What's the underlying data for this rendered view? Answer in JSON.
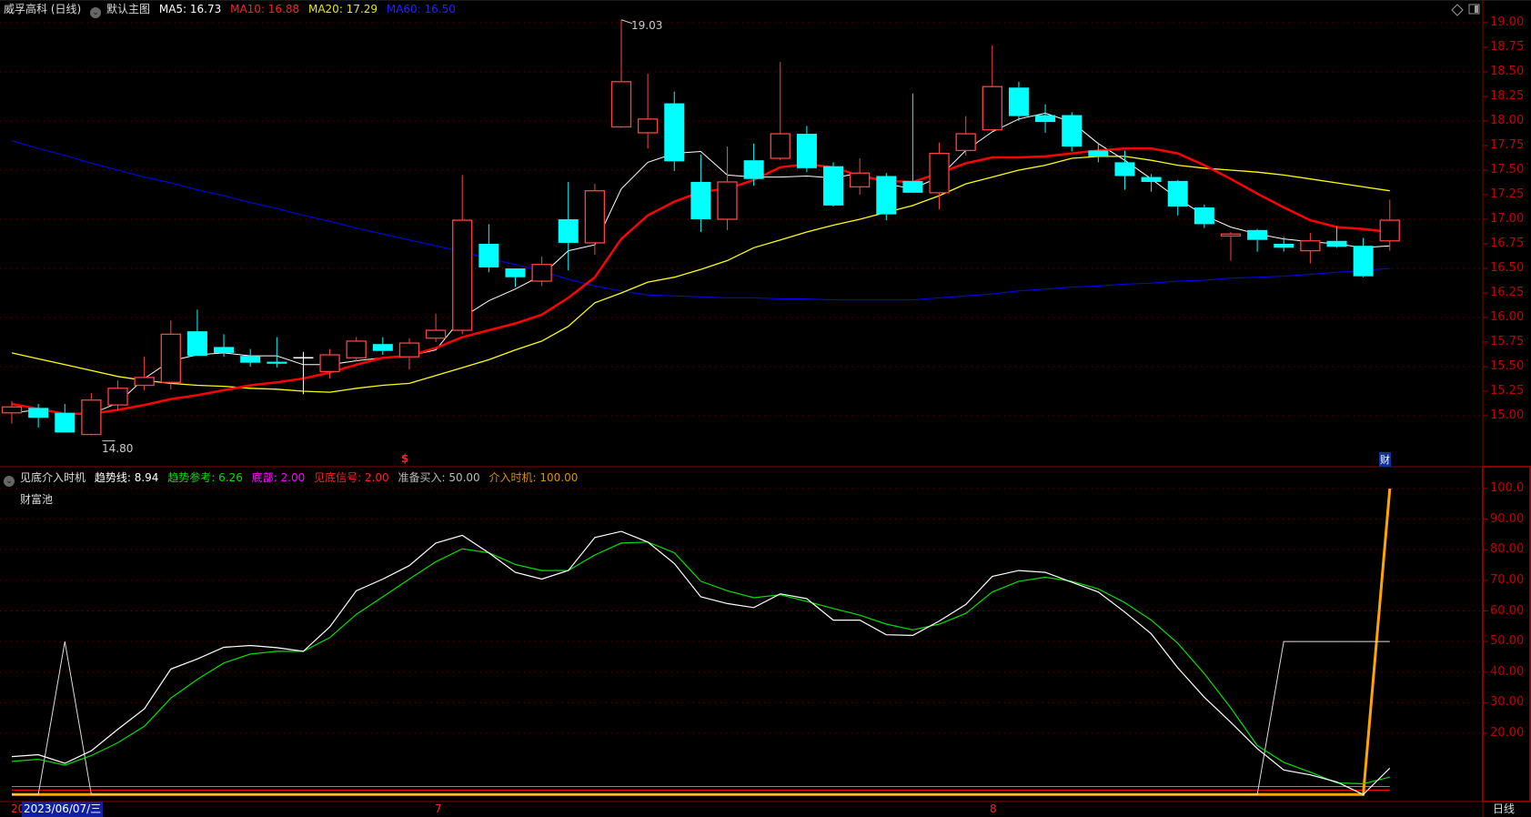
{
  "header": {
    "stock_name": "威孚高科 (日线)",
    "template": "默认主图",
    "ma5": "MA5: 16.73",
    "ma10": "MA10: 16.88",
    "ma20": "MA20: 17.29",
    "ma60": "MA60: 16.50",
    "icons": [
      "diamond-icon",
      "panel-toggle-icon",
      "chevron-down-icon"
    ]
  },
  "indicator_header": {
    "name": "见底介入时机",
    "trend": "趋势线: 8.94",
    "trend_ref": "趋势参考: 6.26",
    "bottom": "底部: 2.00",
    "bottom_signal": "见底信号: 2.00",
    "prepare_buy": "准备买入: 50.00",
    "entry": "介入时机: 100.00",
    "sub_label": "财富池"
  },
  "annotations": {
    "high": "19.03",
    "low": "14.80",
    "dollar_marker": "$",
    "finance_marker": "财"
  },
  "date_bar": {
    "left_year": "20",
    "cursor_date": "2023/06/07/三",
    "month_7": "7",
    "month_8": "8",
    "period": "日线"
  },
  "colors": {
    "up": "#ff4040",
    "down": "#00ffff",
    "ma5": "#ffffff",
    "ma10": "#ff0000",
    "ma20": "#ffff00",
    "ma60": "#0000ff",
    "axis": "#c00000",
    "trend": "#ffffff",
    "trend_ref": "#00e000",
    "entry": "#ffa500"
  },
  "chart_data": [
    {
      "type": "candlestick",
      "title": "威孚高科 (日线)",
      "y_ticks": [
        "19.00",
        "18.75",
        "18.50",
        "18.25",
        "18.00",
        "17.75",
        "17.50",
        "17.25",
        "17.00",
        "16.75",
        "16.50",
        "16.25",
        "16.00",
        "15.75",
        "15.50",
        "15.25",
        "15.00"
      ],
      "ylim": [
        14.6,
        19.25
      ],
      "ohlc": [
        [
          15.03,
          15.15,
          14.92,
          15.09
        ],
        [
          15.08,
          15.12,
          14.88,
          14.98
        ],
        [
          15.03,
          15.12,
          14.83,
          14.83
        ],
        [
          14.81,
          15.23,
          14.8,
          15.16
        ],
        [
          15.11,
          15.36,
          15.05,
          15.28
        ],
        [
          15.31,
          15.6,
          15.26,
          15.39
        ],
        [
          15.34,
          15.97,
          15.27,
          15.83
        ],
        [
          15.86,
          16.08,
          15.61,
          15.61
        ],
        [
          15.7,
          15.83,
          15.6,
          15.64
        ],
        [
          15.61,
          15.68,
          15.5,
          15.54
        ],
        [
          15.55,
          15.8,
          15.49,
          15.53
        ],
        [
          15.59,
          15.65,
          15.22,
          15.59
        ],
        [
          15.45,
          15.68,
          15.38,
          15.62
        ],
        [
          15.59,
          15.8,
          15.55,
          15.76
        ],
        [
          15.73,
          15.8,
          15.62,
          15.66
        ],
        [
          15.6,
          15.79,
          15.47,
          15.74
        ],
        [
          15.79,
          16.04,
          15.75,
          15.87
        ],
        [
          15.87,
          17.45,
          15.83,
          16.99
        ],
        [
          16.75,
          16.95,
          16.46,
          16.51
        ],
        [
          16.5,
          16.5,
          16.31,
          16.41
        ],
        [
          16.37,
          16.62,
          16.32,
          16.54
        ],
        [
          17.0,
          17.38,
          16.48,
          16.76
        ],
        [
          16.76,
          17.36,
          16.64,
          17.29
        ],
        [
          17.94,
          19.03,
          17.93,
          18.4
        ],
        [
          17.88,
          18.48,
          17.72,
          18.02
        ],
        [
          18.18,
          18.3,
          17.49,
          17.59
        ],
        [
          17.38,
          17.66,
          16.87,
          17.0
        ],
        [
          17.0,
          17.74,
          16.89,
          17.38
        ],
        [
          17.6,
          17.77,
          17.34,
          17.41
        ],
        [
          17.62,
          18.6,
          17.6,
          17.87
        ],
        [
          17.87,
          17.95,
          17.48,
          17.52
        ],
        [
          17.54,
          17.58,
          17.13,
          17.14
        ],
        [
          17.33,
          17.62,
          17.25,
          17.47
        ],
        [
          17.44,
          17.47,
          16.99,
          17.05
        ],
        [
          17.39,
          18.28,
          17.27,
          17.27
        ],
        [
          17.27,
          17.78,
          17.1,
          17.67
        ],
        [
          17.7,
          18.05,
          17.65,
          17.87
        ],
        [
          17.91,
          18.77,
          17.9,
          18.35
        ],
        [
          18.34,
          18.4,
          18.0,
          18.05
        ],
        [
          18.06,
          18.17,
          17.88,
          17.99
        ],
        [
          18.06,
          18.09,
          17.69,
          17.74
        ],
        [
          17.7,
          17.78,
          17.58,
          17.64
        ],
        [
          17.58,
          17.7,
          17.3,
          17.44
        ],
        [
          17.43,
          17.46,
          17.28,
          17.38
        ],
        [
          17.39,
          17.4,
          17.04,
          17.13
        ],
        [
          17.12,
          17.15,
          16.91,
          16.95
        ],
        [
          16.83,
          16.87,
          16.58,
          16.85
        ],
        [
          16.89,
          16.9,
          16.67,
          16.79
        ],
        [
          16.75,
          16.82,
          16.67,
          16.71
        ],
        [
          16.68,
          16.86,
          16.55,
          16.78
        ],
        [
          16.78,
          16.93,
          16.71,
          16.72
        ],
        [
          16.73,
          16.81,
          16.41,
          16.42
        ],
        [
          16.78,
          17.2,
          16.68,
          16.99
        ]
      ],
      "ma5": [
        15.03,
        15.06,
        15.02,
        15.02,
        15.13,
        15.38,
        15.56,
        15.62,
        15.64,
        15.61,
        15.61,
        15.52,
        15.52,
        15.56,
        15.59,
        15.61,
        15.67,
        16.0,
        16.17,
        16.29,
        16.43,
        16.68,
        16.74,
        17.31,
        17.58,
        17.67,
        17.69,
        17.45,
        17.43,
        17.43,
        17.44,
        17.42,
        17.47,
        17.36,
        17.31,
        17.43,
        17.7,
        17.89,
        18.02,
        18.08,
        17.99,
        17.77,
        17.6,
        17.41,
        17.21,
        17.04,
        16.92,
        16.85,
        16.8,
        16.77,
        16.75,
        16.71,
        16.73
      ],
      "ma10": [
        15.12,
        15.07,
        15.02,
        15.02,
        15.06,
        15.11,
        15.17,
        15.21,
        15.26,
        15.31,
        15.34,
        15.38,
        15.44,
        15.52,
        15.59,
        15.61,
        15.69,
        15.8,
        15.87,
        15.94,
        16.03,
        16.2,
        16.41,
        16.8,
        17.04,
        17.18,
        17.28,
        17.31,
        17.4,
        17.53,
        17.56,
        17.53,
        17.44,
        17.39,
        17.38,
        17.47,
        17.57,
        17.63,
        17.63,
        17.64,
        17.67,
        17.7,
        17.72,
        17.72,
        17.67,
        17.55,
        17.41,
        17.26,
        17.12,
        16.99,
        16.92,
        16.9,
        16.87
      ],
      "ma20": [
        15.64,
        15.58,
        15.52,
        15.46,
        15.4,
        15.36,
        15.33,
        15.31,
        15.3,
        15.28,
        15.27,
        15.25,
        15.24,
        15.28,
        15.31,
        15.33,
        15.41,
        15.49,
        15.57,
        15.67,
        15.76,
        15.91,
        16.15,
        16.25,
        16.36,
        16.41,
        16.49,
        16.58,
        16.71,
        16.79,
        16.87,
        16.94,
        17.0,
        17.07,
        17.14,
        17.24,
        17.36,
        17.43,
        17.5,
        17.55,
        17.62,
        17.64,
        17.64,
        17.6,
        17.55,
        17.52,
        17.5,
        17.48,
        17.45,
        17.41,
        17.37,
        17.33,
        17.29
      ],
      "ma60": [
        17.8,
        17.72,
        17.65,
        17.57,
        17.5,
        17.43,
        17.37,
        17.3,
        17.24,
        17.17,
        17.11,
        17.04,
        16.98,
        16.91,
        16.85,
        16.79,
        16.73,
        16.67,
        16.6,
        16.54,
        16.47,
        16.39,
        16.32,
        16.27,
        16.23,
        16.22,
        16.21,
        16.2,
        16.2,
        16.19,
        16.19,
        16.18,
        16.18,
        16.18,
        16.18,
        16.2,
        16.22,
        16.24,
        16.27,
        16.29,
        16.31,
        16.32,
        16.34,
        16.35,
        16.37,
        16.38,
        16.4,
        16.41,
        16.42,
        16.44,
        16.46,
        16.48,
        16.5
      ]
    },
    {
      "type": "line",
      "title": "见底介入时机",
      "y_ticks": [
        "100.0",
        "90.00",
        "80.00",
        "70.00",
        "60.00",
        "50.00",
        "40.00",
        "30.00",
        "20.00"
      ],
      "ylim": [
        0,
        100
      ],
      "series": [
        {
          "name": "趋势线",
          "values": [
            12.4,
            13,
            10.2,
            14.3,
            21.3,
            28,
            41,
            44.3,
            48.1,
            48.7,
            48,
            46.8,
            54.8,
            66.6,
            70.4,
            74.8,
            82.2,
            84.7,
            79,
            72.6,
            70.4,
            73.2,
            84,
            86,
            82.5,
            75.5,
            64.6,
            62.4,
            61.1,
            65.6,
            64,
            57,
            57,
            52.2,
            52,
            56.7,
            62.1,
            71.3,
            73.2,
            72.6,
            69.4,
            66.2,
            59.6,
            52.5,
            41.4,
            31.8,
            23.6,
            15,
            8,
            6.4,
            4.1,
            0,
            8.6
          ]
        },
        {
          "name": "趋势参考",
          "values": [
            10.8,
            11.5,
            9.6,
            12.7,
            16.9,
            22.3,
            31.5,
            37.6,
            43,
            45.9,
            46.8,
            46.8,
            51.3,
            58.9,
            64.6,
            70.4,
            76.1,
            80.3,
            79,
            75.2,
            73.2,
            73.2,
            78.3,
            82.2,
            82.5,
            79,
            69.7,
            66.6,
            64.3,
            65.3,
            63.1,
            60.8,
            58.6,
            55.7,
            53.8,
            55.7,
            59.2,
            66.2,
            69.7,
            71,
            69.7,
            67.2,
            62.7,
            57,
            49.4,
            39.5,
            28.3,
            16,
            10.5,
            7.3,
            3.8,
            3.5,
            5.7
          ]
        },
        {
          "name": "底部",
          "value": 2.0
        },
        {
          "name": "见底信号",
          "value": 2.0
        },
        {
          "name": "准备买入",
          "values": [
            0,
            0,
            50,
            0,
            0,
            0,
            0,
            0,
            0,
            0,
            0,
            0,
            0,
            0,
            0,
            0,
            0,
            0,
            0,
            0,
            0,
            0,
            0,
            0,
            0,
            0,
            0,
            0,
            0,
            0,
            0,
            0,
            0,
            0,
            0,
            0,
            0,
            0,
            0,
            0,
            0,
            0,
            0,
            0,
            0,
            0,
            0,
            0,
            50,
            50,
            50,
            50,
            50
          ]
        },
        {
          "name": "介入时机",
          "values": [
            0,
            0,
            0,
            0,
            0,
            0,
            0,
            0,
            0,
            0,
            0,
            0,
            0,
            0,
            0,
            0,
            0,
            0,
            0,
            0,
            0,
            0,
            0,
            0,
            0,
            0,
            0,
            0,
            0,
            0,
            0,
            0,
            0,
            0,
            0,
            0,
            0,
            0,
            0,
            0,
            0,
            0,
            0,
            0,
            0,
            0,
            0,
            0,
            0,
            0,
            0,
            0,
            100
          ]
        }
      ]
    }
  ]
}
